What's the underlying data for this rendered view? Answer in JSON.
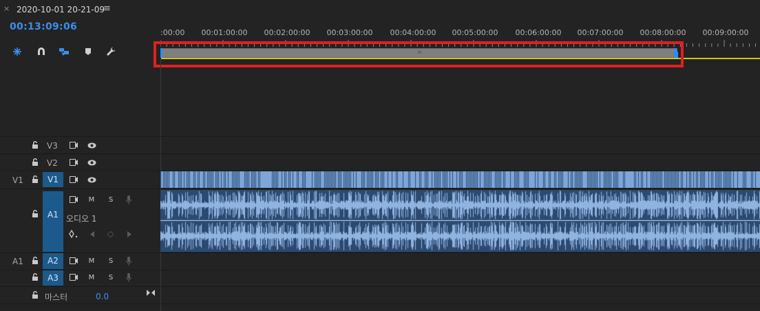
{
  "tab": {
    "close_glyph": "×",
    "title": "2020-10-01 20-21-09",
    "menu_glyph": "≡"
  },
  "timecode": "00:13:09:06",
  "tools": [
    {
      "name": "snap-nest-icon"
    },
    {
      "name": "snap-magnet-icon"
    },
    {
      "name": "linked-selection-icon"
    },
    {
      "name": "add-marker-icon"
    },
    {
      "name": "timeline-settings-wrench-icon"
    }
  ],
  "ruler": {
    "labels": [
      ":00:00",
      "00:01:00:00",
      "00:02:00:00",
      "00:03:00:00",
      "00:04:00:00",
      "00:05:00:00",
      "00:06:00:00",
      "00:07:00:00",
      "00:08:00:00",
      "00:09:00:00"
    ]
  },
  "workbar": {
    "mid_mark": "III"
  },
  "tracks": {
    "v3": {
      "name": "V3"
    },
    "v2": {
      "name": "V2"
    },
    "v1": {
      "source": "V1",
      "name": "V1"
    },
    "a1": {
      "name": "A1",
      "label": "오디오 1",
      "mute": "M",
      "solo": "S"
    },
    "a2": {
      "source": "A1",
      "name": "A2",
      "mute": "M",
      "solo": "S"
    },
    "a3": {
      "name": "A3",
      "mute": "M",
      "solo": "S"
    },
    "master": {
      "name": "마스터",
      "value": "0.0"
    }
  },
  "colors": {
    "accent": "#3d8ee8",
    "clip": "#7ea6d8",
    "work_area": "#d3c512",
    "highlight": "#e02020"
  }
}
